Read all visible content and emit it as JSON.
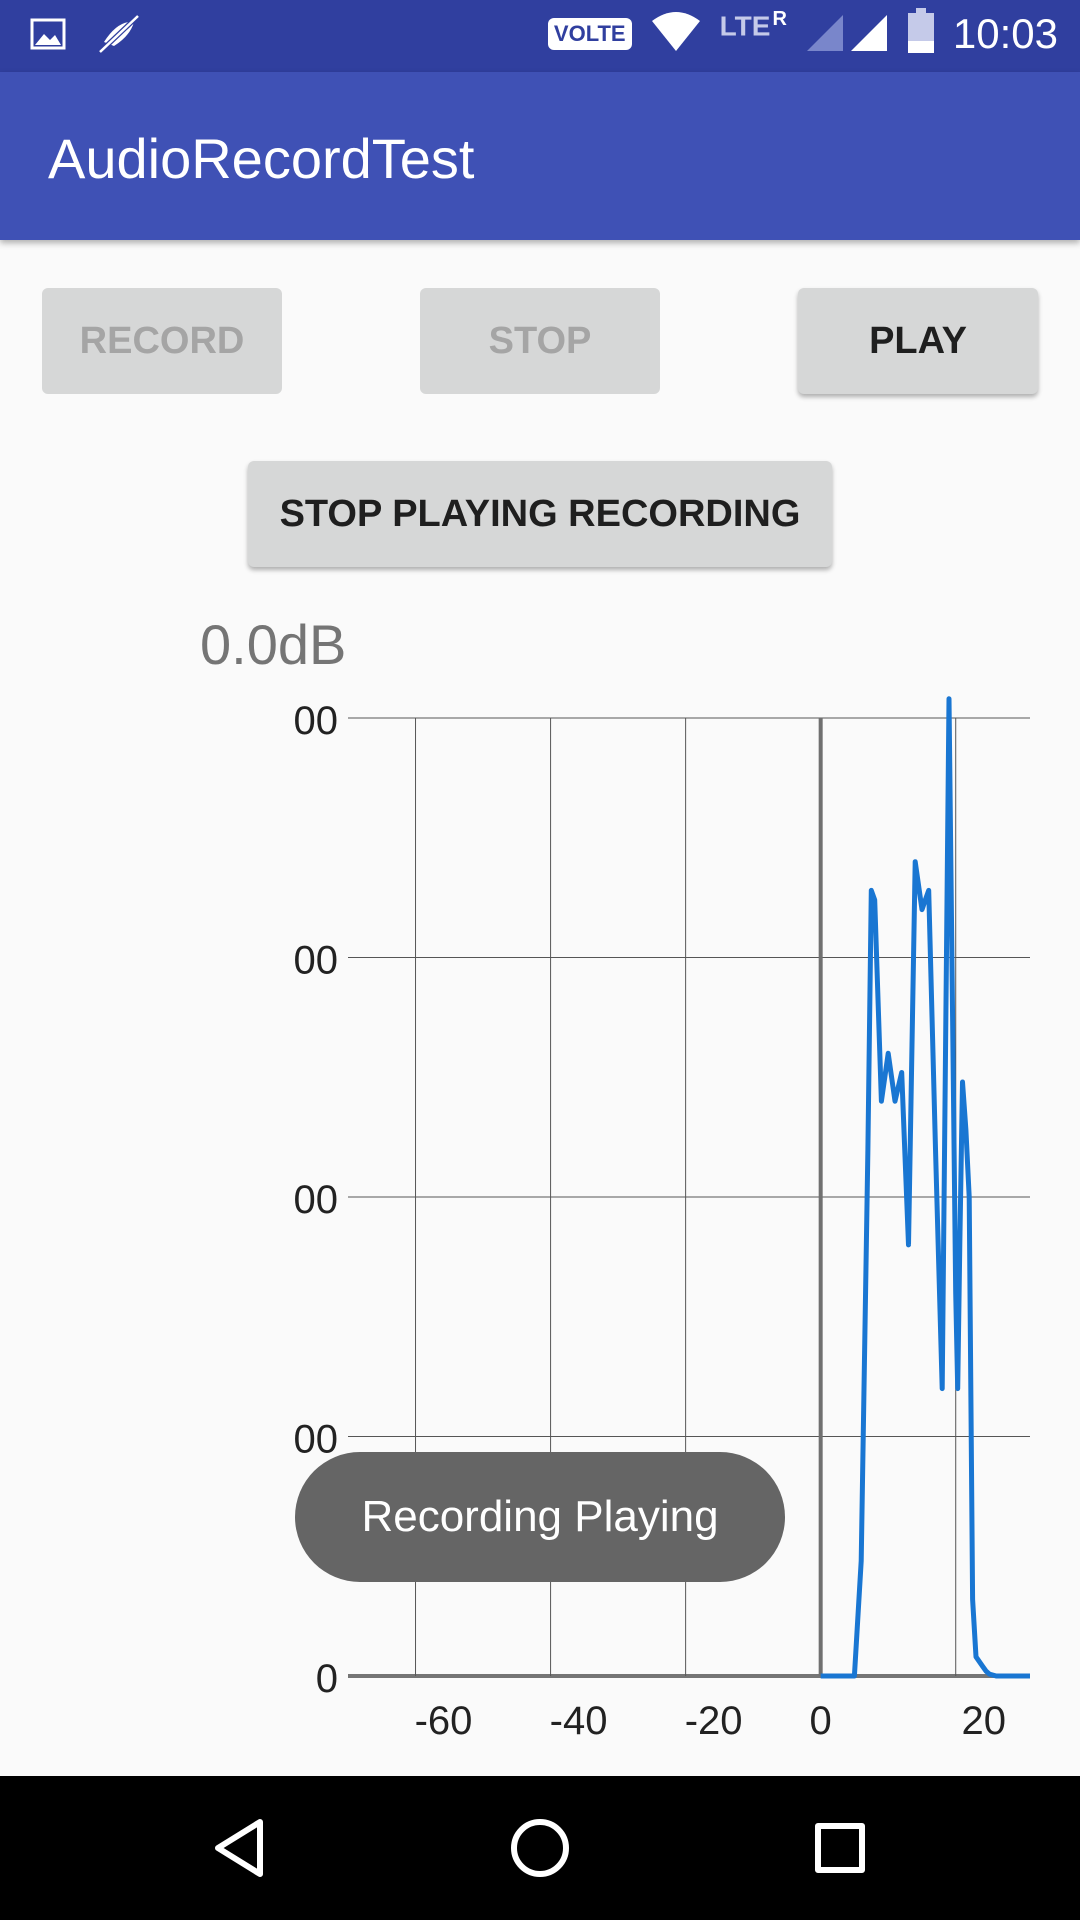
{
  "status_bar": {
    "time": "10:03",
    "volte": "VOLTE",
    "network": "LTE",
    "roaming": "R",
    "icons": [
      "image-icon",
      "mute-icon",
      "wifi-icon",
      "signal-icon",
      "battery-icon"
    ]
  },
  "app_bar": {
    "title": "AudioRecordTest",
    "color": "#3f51b5"
  },
  "buttons": {
    "record": "RECORD",
    "stop": "STOP",
    "play": "PLAY",
    "stop_playing": "STOP PLAYING RECORDING"
  },
  "level": "0.0dB",
  "chart_data": {
    "type": "line",
    "y_tick_labels": [
      "00",
      "00",
      "00",
      "00",
      "0"
    ],
    "x_tick_labels": [
      "-60",
      "-40",
      "-20",
      "0",
      "20"
    ],
    "x_ticks": [
      -60,
      -40,
      -20,
      0,
      20
    ],
    "xlim": [
      -70,
      31
    ],
    "ylim": [
      0,
      100
    ],
    "grid": true,
    "series_color": "#1976d2",
    "series": [
      {
        "x": [
          0,
          5,
          6,
          7,
          7.5,
          8,
          9,
          10,
          11,
          12,
          13,
          14,
          15,
          15.5,
          16,
          17,
          18,
          19,
          20,
          20.3,
          20.6,
          21,
          21.5,
          22,
          22.5,
          23,
          24,
          24.5,
          25,
          26,
          27,
          28,
          29,
          30,
          31
        ],
        "y": [
          0,
          0,
          12,
          55,
          82,
          81,
          60,
          65,
          60,
          63,
          45,
          85,
          80,
          81,
          82,
          55,
          30,
          102,
          40,
          30,
          45,
          62,
          57,
          50,
          8,
          2,
          1,
          0.5,
          0.2,
          0,
          0,
          0,
          0,
          0,
          0
        ]
      }
    ]
  },
  "toast": "Recording Playing",
  "nav_bar": {
    "icons": [
      "back-icon",
      "home-icon",
      "recents-icon"
    ]
  }
}
